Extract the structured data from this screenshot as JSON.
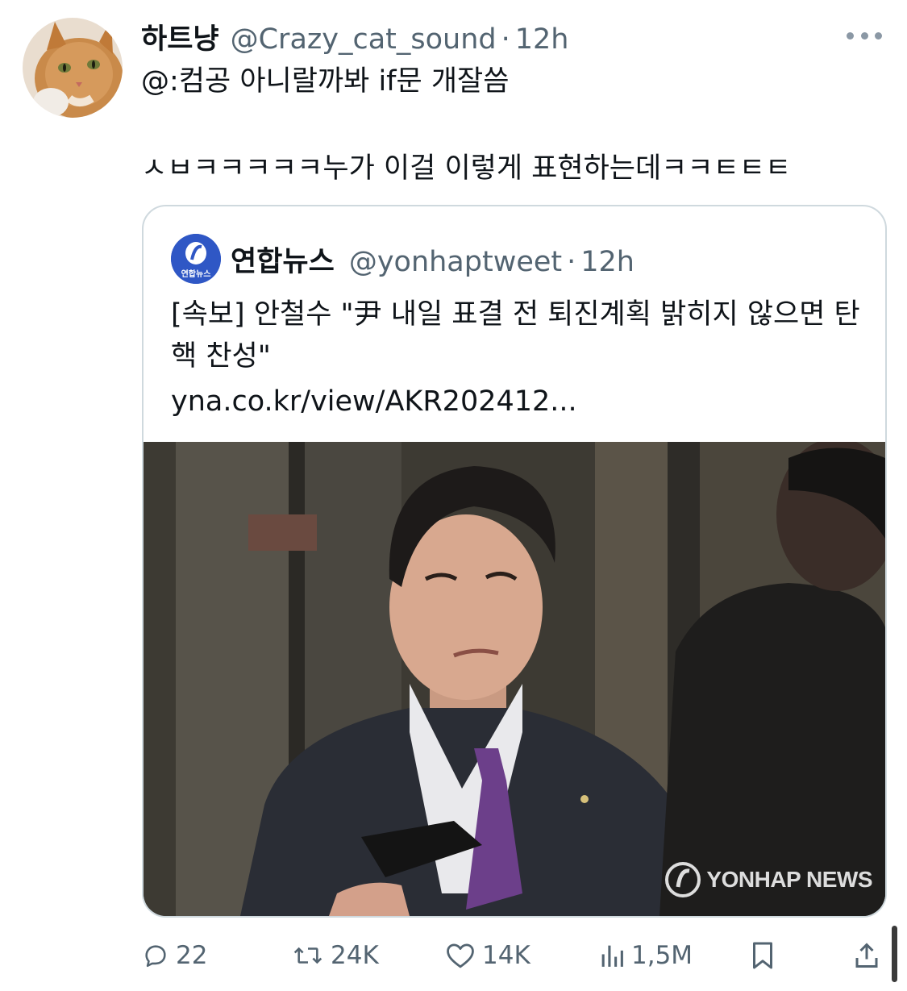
{
  "tweet": {
    "display_name": "하트냥",
    "handle": "@Crazy_cat_sound",
    "separator": "·",
    "time": "12h",
    "line1": "@:컴공 아니랄까봐 if문 개잘씀",
    "line2": "ㅅㅂㅋㅋㅋㅋㅋ누가 이걸 이렇게 표현하는데ㅋㅋㅌㅌㅌ",
    "more_icon": "more-horizontal-icon"
  },
  "quote": {
    "display_name": "연합뉴스",
    "handle": "@yonhaptweet",
    "separator": "·",
    "time": "12h",
    "avatar_label": "연합뉴스",
    "text": "[속보] 안철수 \"尹 내일 표결 전 퇴진계획 밝히지 않으면 탄핵 찬성\"",
    "link": "yna.co.kr/view/AKR202412...",
    "image_watermark": "YONHAP NEWS"
  },
  "actions": {
    "reply_count": "22",
    "retweet_count": "24K",
    "like_count": "14K",
    "views_count": "1,5M"
  },
  "colors": {
    "text_primary": "#0f1419",
    "text_secondary": "#536471",
    "border": "#cfd9de",
    "yonhap_blue": "#2f57c5"
  }
}
